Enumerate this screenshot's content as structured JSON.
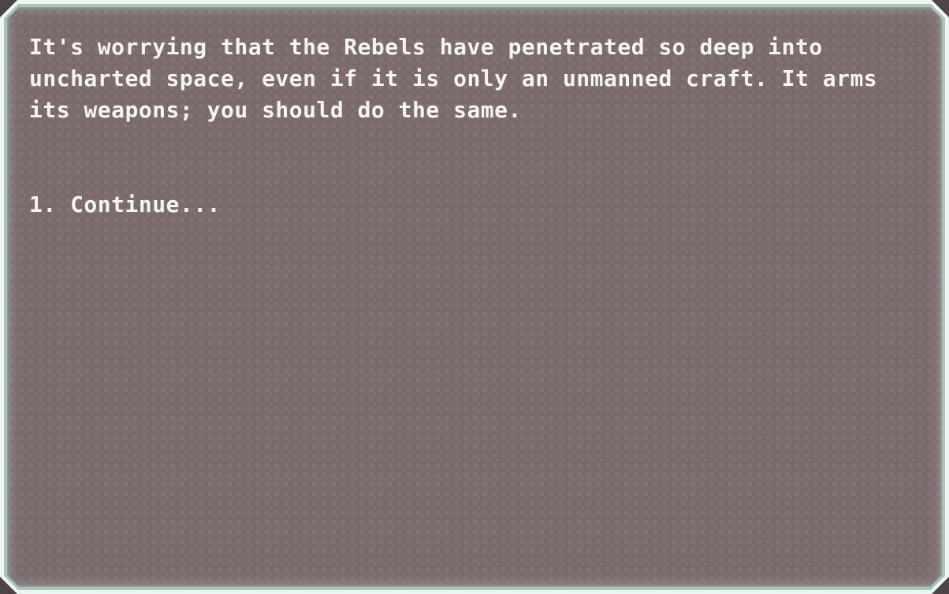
{
  "event": {
    "text": "It's worrying that the Rebels have penetrated so deep into uncharted space, even if it is only an unmanned craft. It arms its weapons; you should do the same.",
    "choices": [
      {
        "number": "1.",
        "label": "Continue..."
      }
    ]
  },
  "colors": {
    "panel_background": "#7b6a6b",
    "frame_border": "#eef6f1",
    "text": "#f4f4f4"
  }
}
